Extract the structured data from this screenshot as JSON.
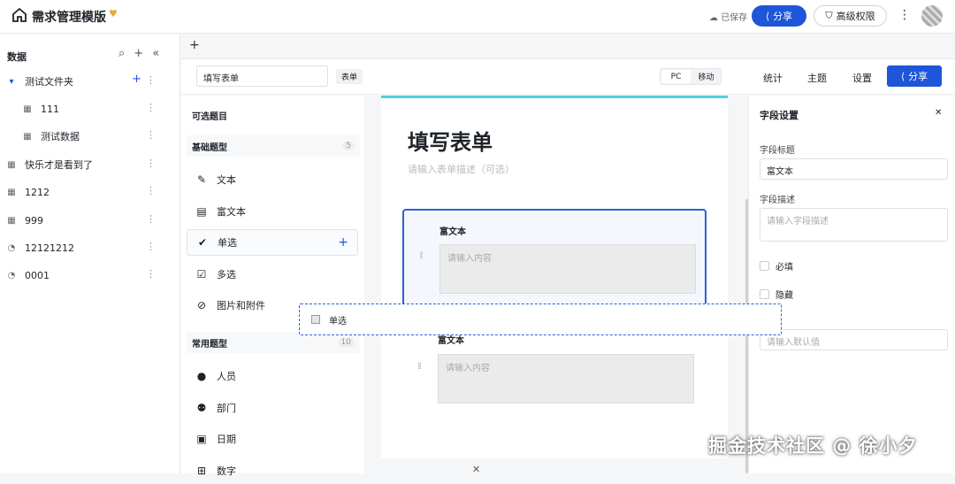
{
  "topbar": {
    "title": "需求管理模版",
    "saved": "已保存",
    "share": "分享",
    "permission": "高级权限"
  },
  "sidebar": {
    "heading": "数据",
    "items": [
      {
        "label": "测试文件夹",
        "icon": "folder-caret"
      },
      {
        "label": "111",
        "icon": "table"
      },
      {
        "label": "测试数据",
        "icon": "table"
      },
      {
        "label": "快乐才是看到了",
        "icon": "table"
      },
      {
        "label": "1212",
        "icon": "table"
      },
      {
        "label": "999",
        "icon": "table"
      },
      {
        "label": "12121212",
        "icon": "dashboard"
      },
      {
        "label": "0001",
        "icon": "dashboard"
      }
    ]
  },
  "formbar": {
    "name": "填写表单",
    "tag": "表单",
    "seg_pc": "PC",
    "seg_mobile": "移动",
    "stats": "统计",
    "theme": "主题",
    "settings": "设置",
    "share": "分享"
  },
  "palette": {
    "title": "可选题目",
    "basic": {
      "label": "基础题型",
      "count": "5"
    },
    "basic_items": [
      "文本",
      "富文本",
      "单选",
      "多选",
      "图片和附件"
    ],
    "common": {
      "label": "常用题型",
      "count": "10"
    },
    "common_items": [
      "人员",
      "部门",
      "日期",
      "数字"
    ]
  },
  "canvas": {
    "title": "填写表单",
    "desc": "请输入表单描述（可选）",
    "field1": {
      "label": "富文本",
      "placeholder": "请输入内容"
    },
    "field2": {
      "label": "富文本",
      "placeholder": "请输入内容"
    }
  },
  "props": {
    "title": "字段设置",
    "field_title_label": "字段标题",
    "field_title_value": "富文本",
    "field_desc_label": "字段描述",
    "field_desc_placeholder": "请输入字段描述",
    "required": "必填",
    "hidden": "隐藏",
    "default_placeholder": "请输入默认值"
  },
  "drag_ghost": "单选",
  "watermark": "掘金技术社区 @ 徐小夕",
  "colors": {
    "primary": "#1e56d9",
    "accent": "#4fd0e0"
  }
}
